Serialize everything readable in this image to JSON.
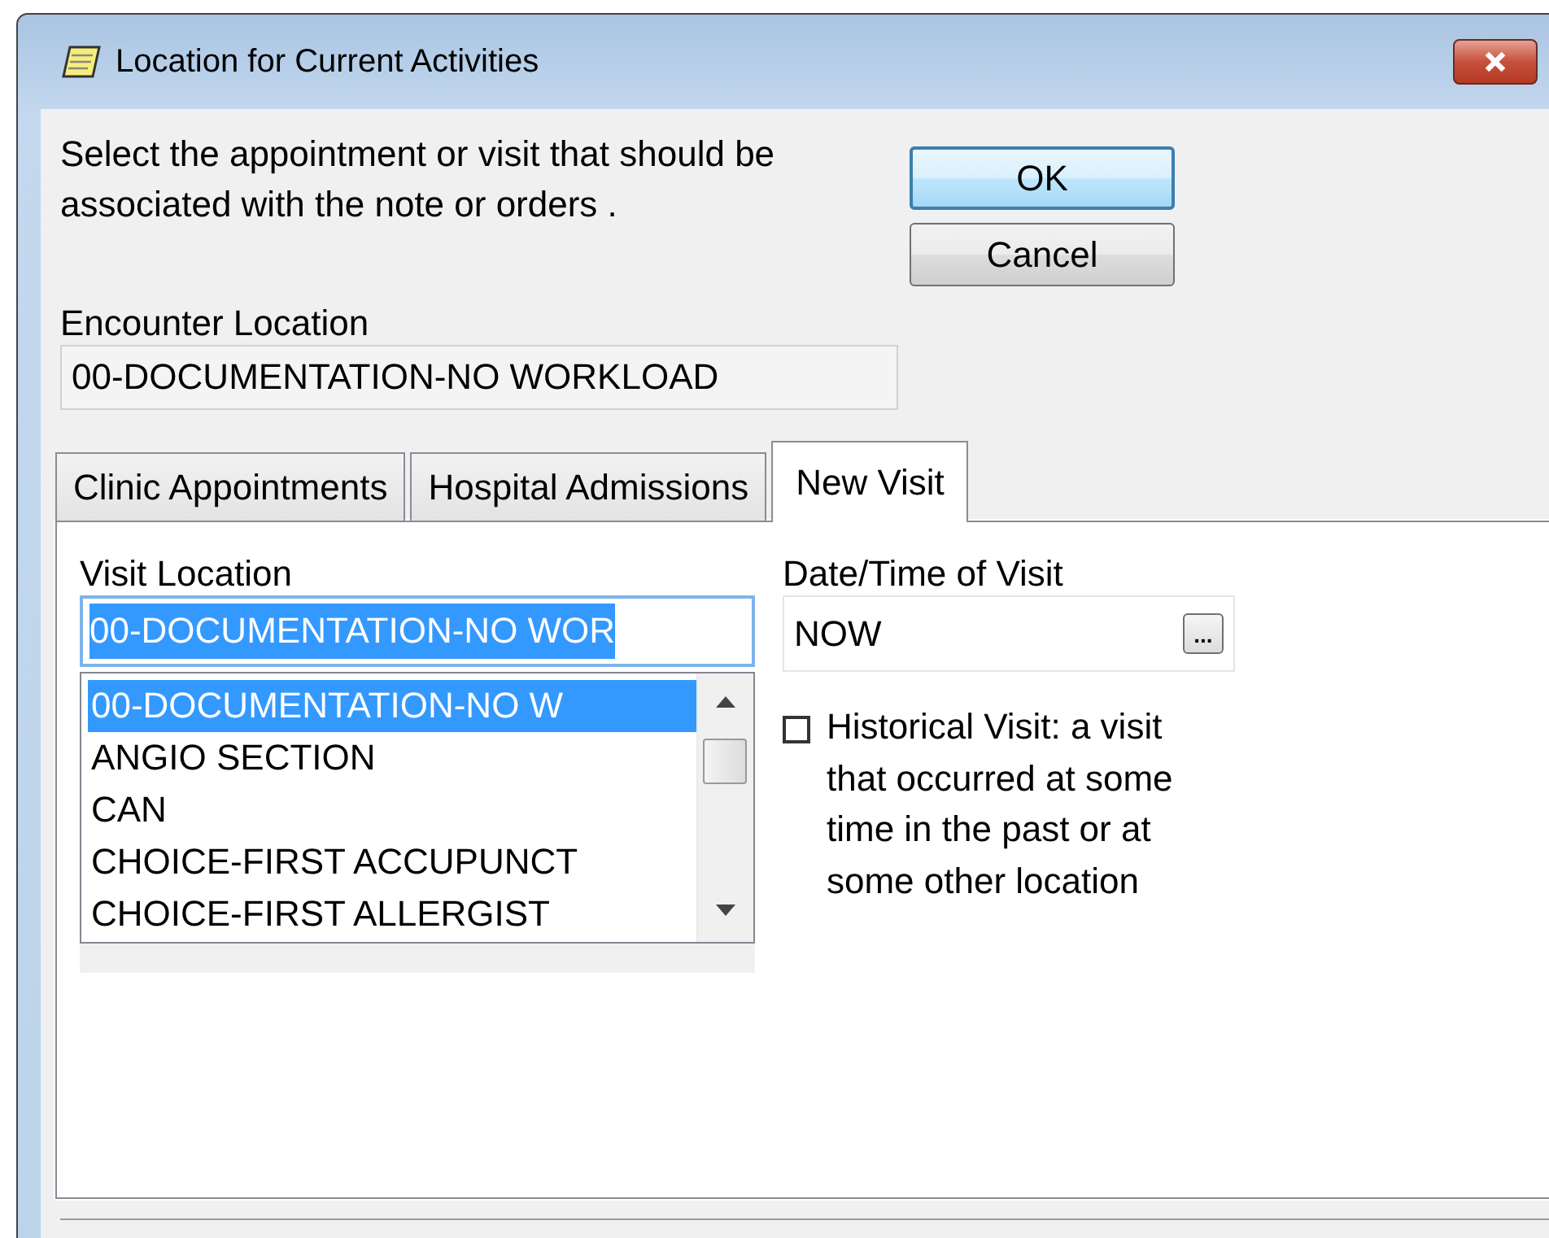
{
  "window": {
    "title": "Location for Current Activities"
  },
  "instructions": "Select the appointment or visit that should be associated with the note or orders .",
  "buttons": [
    {
      "label": "OK",
      "kind": "default"
    },
    {
      "label": "Cancel",
      "kind": "normal"
    }
  ],
  "encounter_location": {
    "label": "Encounter Location",
    "value": "00-DOCUMENTATION-NO WORKLOAD"
  },
  "tabs": [
    {
      "label": "Clinic Appointments",
      "selected": false
    },
    {
      "label": "Hospital Admissions",
      "selected": false
    },
    {
      "label": "New Visit",
      "selected": true
    }
  ],
  "visit_location": {
    "label": "Visit Location",
    "value": "00-DOCUMENTATION-NO WOR",
    "items": [
      {
        "text": "00-DOCUMENTATION-NO W",
        "selected": true
      },
      {
        "text": "ANGIO SECTION",
        "selected": false
      },
      {
        "text": "CAN",
        "selected": false
      },
      {
        "text": "CHOICE-FIRST ACCUPUNCT",
        "selected": false
      },
      {
        "text": "CHOICE-FIRST ALLERGIST",
        "selected": false
      }
    ]
  },
  "date_time": {
    "label": "Date/Time of Visit",
    "value": "NOW",
    "button": "..."
  },
  "historical_visit": {
    "label": "Historical Visit: a visit that occurred at some time in the past or at some other location",
    "checked": false
  }
}
